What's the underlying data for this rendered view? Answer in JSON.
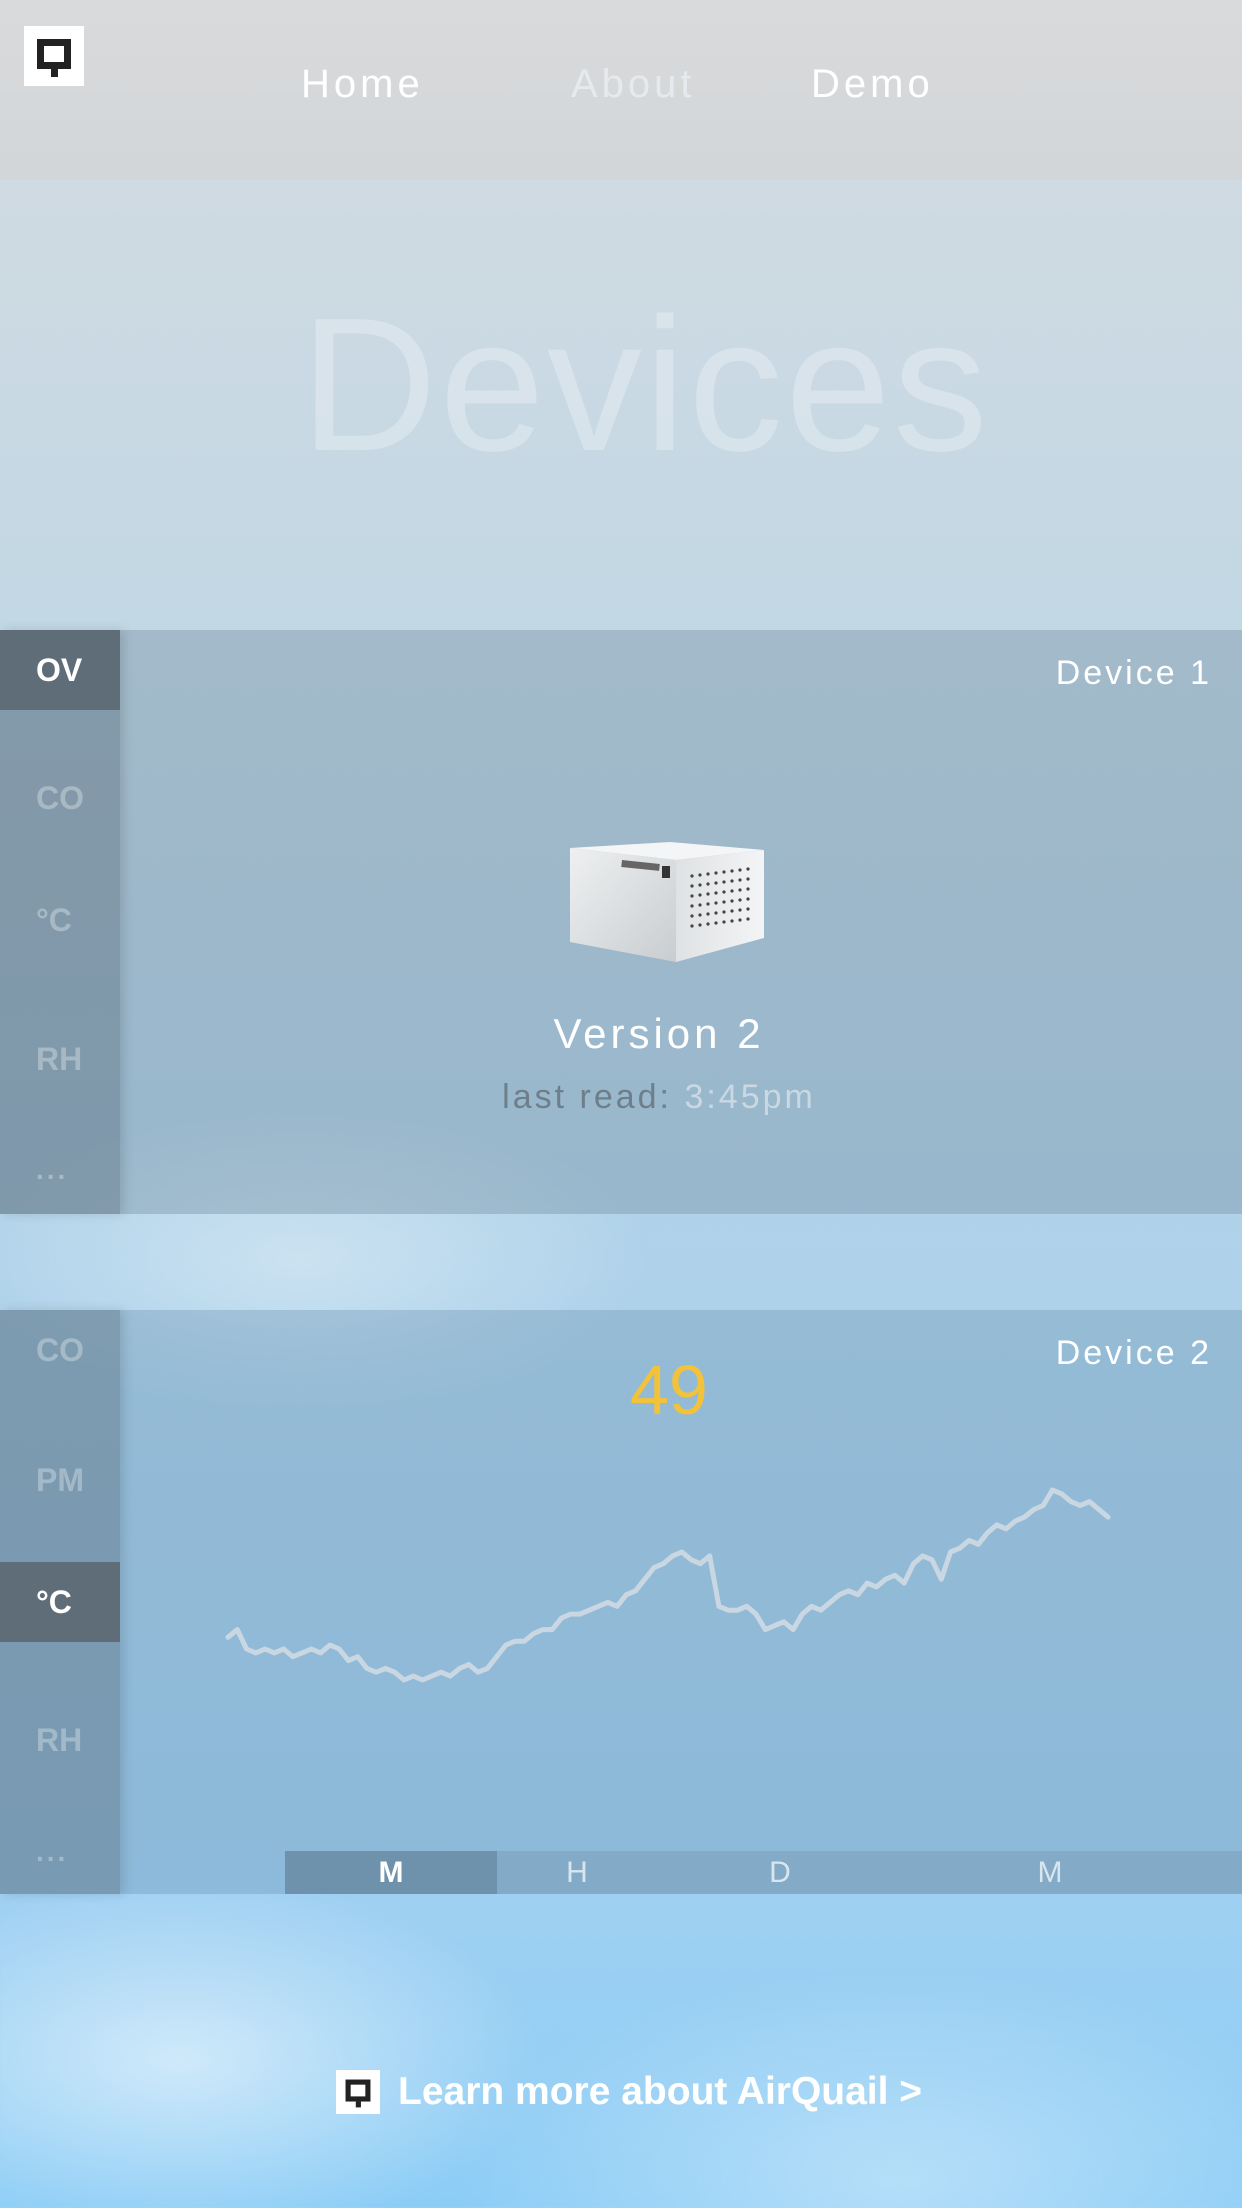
{
  "header": {
    "logo_icon": "airquail-logo-icon",
    "nav": [
      {
        "label": "Home"
      },
      {
        "label": "About"
      },
      {
        "label": "Demo"
      }
    ]
  },
  "hero": {
    "title": "Devices"
  },
  "devices": [
    {
      "title": "Device 1",
      "sidebar": [
        {
          "label": "OV",
          "active": true
        },
        {
          "label": "CO",
          "active": false
        },
        {
          "label": "°C",
          "active": false
        },
        {
          "label": "RH",
          "active": false
        },
        {
          "label": "..."
        }
      ],
      "product_image_icon": "airquail-device-image",
      "version": "Version 2",
      "last_read_label": "last read:",
      "last_read_time": "3:45pm"
    },
    {
      "title": "Device 2",
      "sidebar": [
        {
          "label": "CO",
          "active": false
        },
        {
          "label": "PM",
          "active": false
        },
        {
          "label": "°C",
          "active": true
        },
        {
          "label": "RH",
          "active": false
        },
        {
          "label": "..."
        }
      ],
      "current_reading": "49",
      "reading_color": "#f3c23b",
      "ranges": [
        {
          "label": "M",
          "active": true
        },
        {
          "label": "H",
          "active": false
        },
        {
          "label": "D",
          "active": false
        },
        {
          "label": "M",
          "active": false
        }
      ]
    }
  ],
  "chart_data": {
    "type": "line",
    "title": "",
    "xlabel": "",
    "ylabel": "",
    "grid": false,
    "series": [
      {
        "values": [
          29,
          31,
          26,
          25,
          26,
          25,
          26,
          24,
          25,
          26,
          25,
          27,
          26,
          23,
          24,
          21,
          20,
          21,
          20,
          18,
          19,
          18,
          19,
          20,
          19,
          21,
          22,
          20,
          21,
          24,
          27,
          28,
          28,
          30,
          31,
          31,
          34,
          35,
          35,
          36,
          37,
          38,
          37,
          40,
          41,
          44,
          47,
          48,
          50,
          51,
          49,
          48,
          50,
          37,
          36,
          36,
          37,
          35,
          31,
          32,
          33,
          31,
          35,
          37,
          36,
          38,
          40,
          41,
          40,
          43,
          42,
          44,
          45,
          43,
          48,
          50,
          49,
          44,
          51,
          52,
          54,
          53,
          56,
          58,
          57,
          59,
          60,
          62,
          63,
          67,
          66,
          64,
          63,
          64,
          62,
          60
        ],
        "color": "#c9d7e2"
      }
    ]
  },
  "footer": {
    "logo_icon": "airquail-logo-icon",
    "link_text": "Learn more about AirQuail >"
  }
}
